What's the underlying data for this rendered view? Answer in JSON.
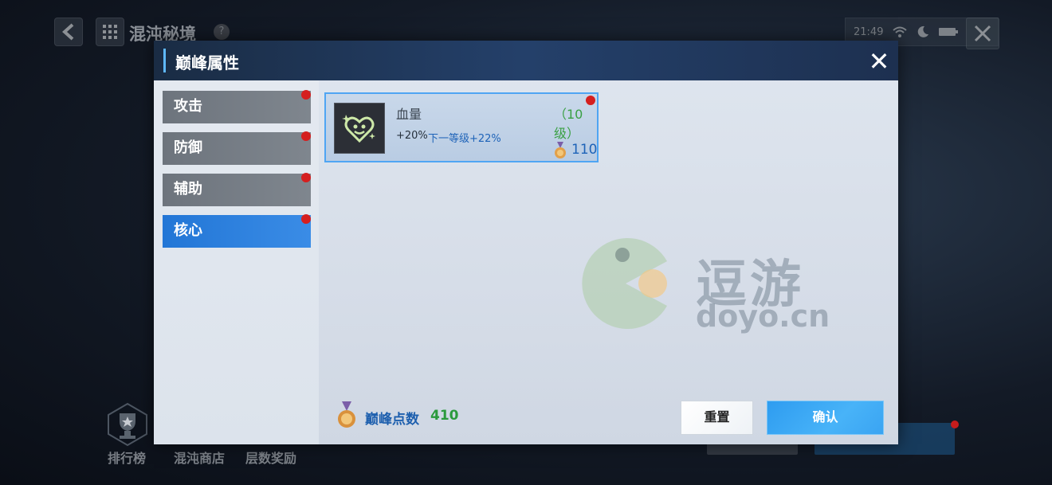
{
  "background": {
    "title": "混沌秘境",
    "help": "?",
    "status": {
      "time": "21:49"
    },
    "nav": [
      {
        "label": "排行榜"
      },
      {
        "label": "混沌商店"
      },
      {
        "label": "层数奖励"
      }
    ]
  },
  "dialog": {
    "title": "巅峰属性",
    "close": "✕",
    "tabs": [
      {
        "label": "攻击",
        "active": false
      },
      {
        "label": "防御",
        "active": false
      },
      {
        "label": "辅助",
        "active": false
      },
      {
        "label": "核心",
        "active": true
      }
    ],
    "attribute": {
      "name": "血量",
      "level": "（10级）",
      "value": "+20%",
      "next": "下一等级+22%",
      "cost": "110"
    },
    "points": {
      "label": "巅峰点数",
      "value": "410"
    },
    "buttons": {
      "reset": "重置",
      "confirm": "确认"
    }
  },
  "watermark": {
    "text": "逗游",
    "sub": "doyo.cn"
  },
  "colors": {
    "accent": "#2276d6",
    "level_green": "#3aa044",
    "red_dot": "#d51f1f"
  }
}
